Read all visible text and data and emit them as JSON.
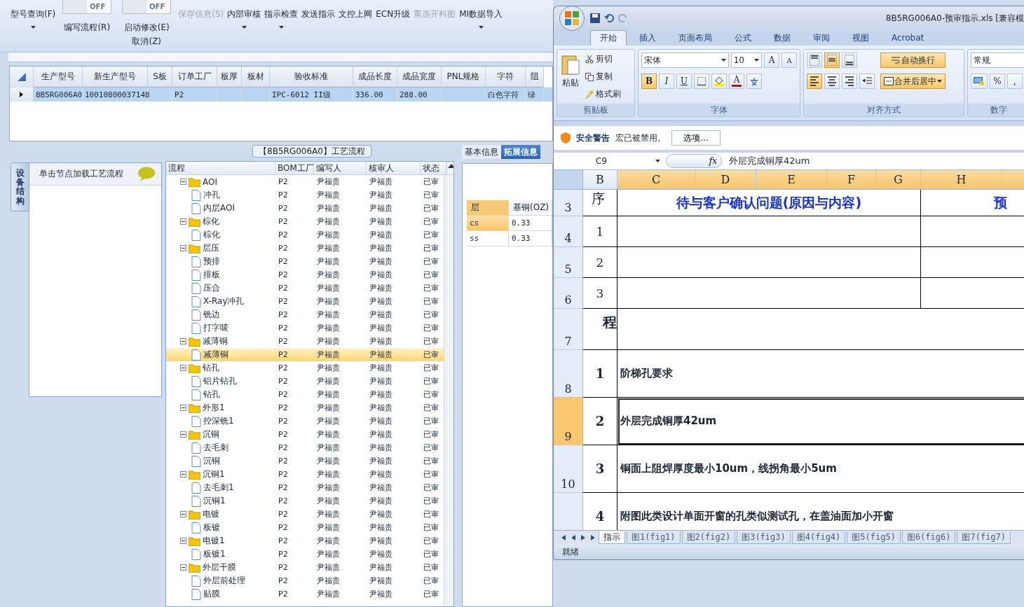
{
  "toolbar": [
    {
      "kind": "button",
      "label": "型号查询(F)",
      "dropdown": true,
      "disabled": false
    },
    {
      "kind": "toggle",
      "switch": "OFF",
      "on": false,
      "label": "编写流程(R)"
    },
    {
      "kind": "toggle",
      "switch": "OFF",
      "on": false,
      "label": "启动修改(E)",
      "sublabel": "取消(Z)"
    },
    {
      "kind": "button",
      "label": "保存信息(S)",
      "dropdown": false,
      "disabled": true
    },
    {
      "kind": "button",
      "label": "内部审核",
      "dropdown": true,
      "disabled": false
    },
    {
      "kind": "button",
      "label": "指示检查",
      "dropdown": true,
      "disabled": false
    },
    {
      "kind": "button",
      "label": "发送指示",
      "dropdown": false,
      "disabled": false
    },
    {
      "kind": "button",
      "label": "文控上网",
      "dropdown": false,
      "disabled": false
    },
    {
      "kind": "button",
      "label": "ECN升级",
      "dropdown": false,
      "disabled": false
    },
    {
      "kind": "button",
      "label": "重选开料图",
      "dropdown": false,
      "disabled": true
    },
    {
      "kind": "button",
      "label": "MI数据导入",
      "dropdown": true,
      "disabled": false
    }
  ],
  "product_grid": {
    "columns": [
      "生产型号",
      "新生产型号",
      "S板",
      "订单工厂",
      "板厚",
      "板材",
      "验收标准",
      "成品长度",
      "成品宽度",
      "PNL规格",
      "字符",
      "阻"
    ],
    "rows": [
      {
        "selected": true,
        "cells": [
          "8B5RG006A0",
          "10010800037148",
          "",
          "P2",
          "",
          "",
          "IPC-6012 II级",
          "336.00",
          "288.00",
          "",
          "白色字符",
          "绿"
        ]
      }
    ]
  },
  "process_panel": {
    "title": "【8B5RG006A0】工艺流程",
    "side_tab": "设备结构",
    "hint": "单击节点加载工艺流程",
    "columns": [
      "流程",
      "BOM工厂",
      "编写人",
      "核审人",
      "状态"
    ],
    "tree": [
      {
        "name": "AOI",
        "bom": "P2",
        "writer": "尹福贵",
        "reviewer": "尹福贵",
        "status": "已审",
        "selected": false,
        "expanded": true,
        "children": [
          {
            "name": "冲孔",
            "bom": "P2",
            "writer": "尹福贵",
            "reviewer": "尹福贵",
            "status": "已审",
            "selected": false
          },
          {
            "name": "内层AOI",
            "bom": "P2",
            "writer": "尹福贵",
            "reviewer": "尹福贵",
            "status": "已审",
            "selected": false
          }
        ]
      },
      {
        "name": "棕化",
        "bom": "P2",
        "writer": "尹福贵",
        "reviewer": "尹福贵",
        "status": "已审",
        "selected": false,
        "expanded": true,
        "children": [
          {
            "name": "棕化",
            "bom": "P2",
            "writer": "尹福贵",
            "reviewer": "尹福贵",
            "status": "已审",
            "selected": false
          }
        ]
      },
      {
        "name": "层压",
        "bom": "P2",
        "writer": "尹福贵",
        "reviewer": "尹福贵",
        "status": "已审",
        "selected": false,
        "expanded": true,
        "children": [
          {
            "name": "预排",
            "bom": "P2",
            "writer": "尹福贵",
            "reviewer": "尹福贵",
            "status": "已审",
            "selected": false
          },
          {
            "name": "排板",
            "bom": "P2",
            "writer": "尹福贵",
            "reviewer": "尹福贵",
            "status": "已审",
            "selected": false
          },
          {
            "name": "压合",
            "bom": "P2",
            "writer": "尹福贵",
            "reviewer": "尹福贵",
            "status": "已审",
            "selected": false
          },
          {
            "name": "X-Ray冲孔",
            "bom": "P2",
            "writer": "尹福贵",
            "reviewer": "尹福贵",
            "status": "已审",
            "selected": false
          },
          {
            "name": "铣边",
            "bom": "P2",
            "writer": "尹福贵",
            "reviewer": "尹福贵",
            "status": "已审",
            "selected": false
          },
          {
            "name": "打字唛",
            "bom": "P2",
            "writer": "尹福贵",
            "reviewer": "尹福贵",
            "status": "已审",
            "selected": false
          }
        ]
      },
      {
        "name": "减薄铜",
        "bom": "P2",
        "writer": "尹福贵",
        "reviewer": "尹福贵",
        "status": "已审",
        "selected": false,
        "expanded": true,
        "children": [
          {
            "name": "减薄铜",
            "bom": "P2",
            "writer": "尹福贵",
            "reviewer": "尹福贵",
            "status": "已审",
            "selected": true
          }
        ]
      },
      {
        "name": "钻孔",
        "bom": "P2",
        "writer": "尹福贵",
        "reviewer": "尹福贵",
        "status": "已审",
        "selected": false,
        "expanded": true,
        "children": [
          {
            "name": "铝片钻孔",
            "bom": "P2",
            "writer": "尹福贵",
            "reviewer": "尹福贵",
            "status": "已审",
            "selected": false
          },
          {
            "name": "钻孔",
            "bom": "P2",
            "writer": "尹福贵",
            "reviewer": "尹福贵",
            "status": "已审",
            "selected": false
          }
        ]
      },
      {
        "name": "外形1",
        "bom": "P2",
        "writer": "尹福贵",
        "reviewer": "尹福贵",
        "status": "已审",
        "selected": false,
        "expanded": true,
        "children": [
          {
            "name": "控深铣1",
            "bom": "P2",
            "writer": "尹福贵",
            "reviewer": "尹福贵",
            "status": "已审",
            "selected": false
          }
        ]
      },
      {
        "name": "沉铜",
        "bom": "P2",
        "writer": "尹福贵",
        "reviewer": "尹福贵",
        "status": "已审",
        "selected": false,
        "expanded": true,
        "children": [
          {
            "name": "去毛刺",
            "bom": "P2",
            "writer": "尹福贵",
            "reviewer": "尹福贵",
            "status": "已审",
            "selected": false
          },
          {
            "name": "沉铜",
            "bom": "P2",
            "writer": "尹福贵",
            "reviewer": "尹福贵",
            "status": "已审",
            "selected": false
          }
        ]
      },
      {
        "name": "沉铜1",
        "bom": "P2",
        "writer": "尹福贵",
        "reviewer": "尹福贵",
        "status": "已审",
        "selected": false,
        "expanded": true,
        "children": [
          {
            "name": "去毛刺1",
            "bom": "P2",
            "writer": "尹福贵",
            "reviewer": "尹福贵",
            "status": "已审",
            "selected": false
          },
          {
            "name": "沉铜1",
            "bom": "P2",
            "writer": "尹福贵",
            "reviewer": "尹福贵",
            "status": "已审",
            "selected": false
          }
        ]
      },
      {
        "name": "电镀",
        "bom": "P2",
        "writer": "尹福贵",
        "reviewer": "尹福贵",
        "status": "已审",
        "selected": false,
        "expanded": true,
        "children": [
          {
            "name": "板镀",
            "bom": "P2",
            "writer": "尹福贵",
            "reviewer": "尹福贵",
            "status": "已审",
            "selected": false
          }
        ]
      },
      {
        "name": "电镀1",
        "bom": "P2",
        "writer": "尹福贵",
        "reviewer": "尹福贵",
        "status": "已审",
        "selected": false,
        "expanded": true,
        "children": [
          {
            "name": "板镀1",
            "bom": "P2",
            "writer": "尹福贵",
            "reviewer": "尹福贵",
            "status": "已审",
            "selected": false
          }
        ]
      },
      {
        "name": "外层干膜",
        "bom": "P2",
        "writer": "尹福贵",
        "reviewer": "尹福贵",
        "status": "已审",
        "selected": false,
        "expanded": true,
        "children": [
          {
            "name": "外层前处理",
            "bom": "P2",
            "writer": "尹福贵",
            "reviewer": "尹福贵",
            "status": "已审",
            "selected": false
          },
          {
            "name": "贴膜",
            "bom": "P2",
            "writer": "尹福贵",
            "reviewer": "尹福贵",
            "status": "已审",
            "selected": false
          }
        ]
      }
    ]
  },
  "info_panel": {
    "tabs": [
      {
        "label": "基本信息",
        "selected": false
      },
      {
        "label": "拓展信息",
        "selected": true
      }
    ],
    "columns": [
      "层",
      "基铜(OZ)"
    ],
    "rows": [
      {
        "selected": true,
        "cells": [
          "cs",
          "0.33"
        ]
      },
      {
        "selected": false,
        "cells": [
          "ss",
          "0.33"
        ]
      }
    ]
  },
  "excel": {
    "title": "8B5RG006A0-预审指示.xls  [兼容模",
    "tabs": [
      {
        "label": "开始",
        "selected": true
      },
      {
        "label": "插入",
        "selected": false
      },
      {
        "label": "页面布局",
        "selected": false
      },
      {
        "label": "公式",
        "selected": false
      },
      {
        "label": "数据",
        "selected": false
      },
      {
        "label": "审阅",
        "selected": false
      },
      {
        "label": "视图",
        "selected": false
      },
      {
        "label": "Acrobat",
        "selected": false
      }
    ],
    "clipboard": {
      "paste": "粘贴",
      "cut": "剪切",
      "copy": "复制",
      "painter": "格式刷",
      "label": "剪贴板"
    },
    "font": {
      "name": "宋体",
      "size": "10",
      "grow": "A",
      "shrink": "A",
      "color_letter": "A",
      "label": "字体",
      "styles": [
        {
          "kind": "bold",
          "label": "B",
          "on": true
        },
        {
          "kind": "italic",
          "label": "I",
          "on": false
        },
        {
          "kind": "underline",
          "label": "U",
          "on": false
        }
      ]
    },
    "align": {
      "label": "对齐方式",
      "vertical": [
        {
          "kind": "top",
          "selected": false
        },
        {
          "kind": "middle",
          "selected": true
        },
        {
          "kind": "bottom",
          "selected": false
        }
      ],
      "horizontal": [
        {
          "kind": "left",
          "selected": true
        },
        {
          "kind": "center",
          "selected": false
        },
        {
          "kind": "right",
          "selected": false
        }
      ],
      "wrap": {
        "label": "自动换行",
        "on": true
      },
      "merge": {
        "label": "合并后居中",
        "on": true
      }
    },
    "number": {
      "format": "常规",
      "percent": "%",
      "comma": ",",
      "label": "数字"
    },
    "security": {
      "title": "安全警告",
      "message": "宏已被禁用。",
      "button": "选项..."
    },
    "formula_bar": {
      "cell": "C9",
      "fx": "fx",
      "formula": "外层完成铜厚42um"
    },
    "sheet": {
      "columns": [
        {
          "label": "B",
          "selected": false
        },
        {
          "label": "C",
          "selected": true
        },
        {
          "label": "D",
          "selected": true
        },
        {
          "label": "E",
          "selected": true
        },
        {
          "label": "F",
          "selected": true
        },
        {
          "label": "G",
          "selected": true
        },
        {
          "label": "H",
          "selected": true
        }
      ],
      "rows": [
        {
          "kind": "header",
          "number": "3",
          "selected": false,
          "label": "序",
          "title": "待与客户确认问题(原因与内容)",
          "side": "预"
        },
        {
          "kind": "question",
          "number": "4",
          "selected": false,
          "label": "1"
        },
        {
          "kind": "question",
          "number": "5",
          "selected": false,
          "label": "2"
        },
        {
          "kind": "question",
          "number": "6",
          "selected": false,
          "label": "3"
        },
        {
          "kind": "section",
          "number": "7",
          "selected": false,
          "label": "程"
        },
        {
          "kind": "item",
          "number": "8",
          "selected": false,
          "label": "1",
          "text": "阶梯孔要求"
        },
        {
          "kind": "item",
          "number": "9",
          "selected": true,
          "label": "2",
          "text": "外层完成铜厚42um"
        },
        {
          "kind": "item",
          "number": "10",
          "selected": false,
          "label": "3",
          "text": "铜面上阻焊厚度最小10um，线拐角最小5um"
        },
        {
          "kind": "item",
          "selected": false,
          "label": "4",
          "text": "附图此类设计单面开窗的孔类似测试孔，在盖油面加小开窗"
        }
      ]
    },
    "sheet_tabs": [
      {
        "label": "指示",
        "selected": true
      },
      {
        "label": "图1(fig1)",
        "selected": false
      },
      {
        "label": "图2(fig2)",
        "selected": false
      },
      {
        "label": "图3(fig3)",
        "selected": false
      },
      {
        "label": "图4(fig4)",
        "selected": false
      },
      {
        "label": "图5(fig5)",
        "selected": false
      },
      {
        "label": "图6(fig6)",
        "selected": false
      },
      {
        "label": "图7(fig7)",
        "selected": false
      }
    ],
    "status": "就绪"
  }
}
